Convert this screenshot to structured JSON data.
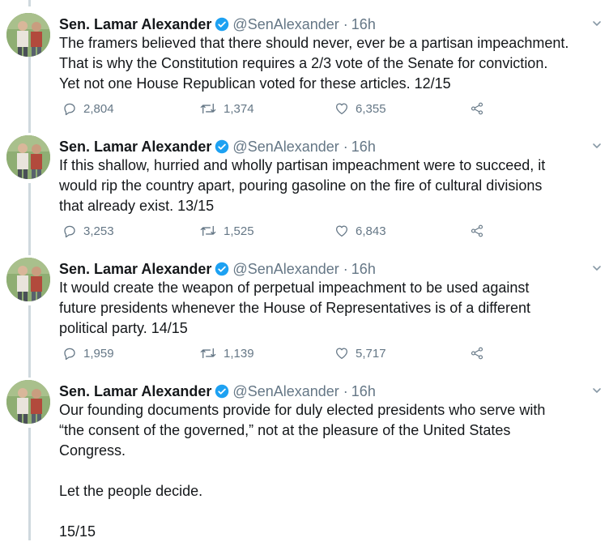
{
  "tweets": [
    {
      "name": "Sen. Lamar Alexander",
      "handle": "@SenAlexander",
      "dot": "·",
      "time": "16h",
      "lines": [
        "The framers believed that there should never, ever be a partisan impeachment.",
        "That is why the Constitution requires a 2/3 vote of the Senate for conviction.",
        "Yet not one House Republican voted for these articles. 12/15"
      ],
      "replies": "2,804",
      "retweets": "1,374",
      "likes": "6,355"
    },
    {
      "name": "Sen. Lamar Alexander",
      "handle": "@SenAlexander",
      "dot": "·",
      "time": "16h",
      "lines": [
        "If this shallow, hurried and wholly partisan impeachment were to succeed, it",
        "would rip the country apart, pouring gasoline on the fire of cultural divisions",
        "that already exist. 13/15"
      ],
      "replies": "3,253",
      "retweets": "1,525",
      "likes": "6,843"
    },
    {
      "name": "Sen. Lamar Alexander",
      "handle": "@SenAlexander",
      "dot": "·",
      "time": "16h",
      "lines": [
        "It would create the weapon of perpetual impeachment to be used against",
        "future presidents whenever the House of Representatives is of a different",
        "political party. 14/15"
      ],
      "replies": "1,959",
      "retweets": "1,139",
      "likes": "5,717"
    },
    {
      "name": "Sen. Lamar Alexander",
      "handle": "@SenAlexander",
      "dot": "·",
      "time": "16h",
      "lines": [
        "Our founding documents provide for duly elected presidents who serve with",
        "“the consent of the governed,” not at the pleasure of the United States",
        "Congress.",
        "",
        "Let the people decide.",
        "",
        "15/15"
      ]
    }
  ],
  "icons": {
    "verified": "verified-badge-icon",
    "caret": "chevron-down-icon",
    "reply": "reply-icon",
    "retweet": "retweet-icon",
    "like": "heart-icon",
    "share": "share-icon"
  },
  "colors": {
    "text": "#14171a",
    "secondary": "#657786",
    "verified": "#1da1f2",
    "thread_line": "#cfd9de"
  }
}
